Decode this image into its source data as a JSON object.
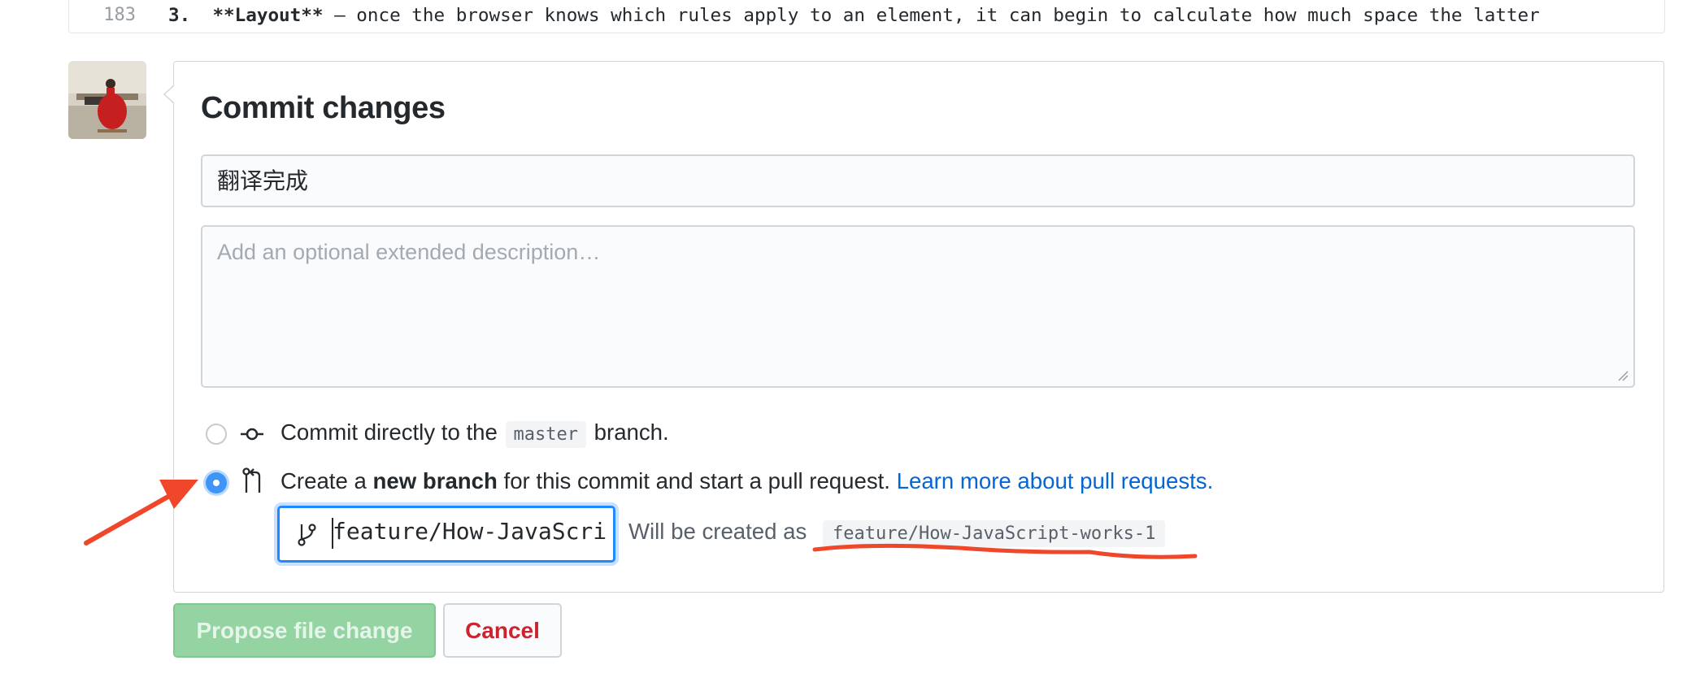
{
  "code_line": {
    "number": "183",
    "marker": "3.",
    "bold_text": "**Layout**",
    "text": " — once the browser knows which rules apply to an element, it can begin to calculate how much space the latter"
  },
  "commit": {
    "title": "Commit changes",
    "summary_value": "翻译完成",
    "description_placeholder": "Add an optional extended description…",
    "option_direct": {
      "before": "Commit directly to the",
      "branch": "master",
      "after": "branch."
    },
    "option_new": {
      "before": "Create a",
      "bold": "new branch",
      "after": "for this commit and start a pull request.",
      "link": "Learn more about pull requests."
    },
    "branch_input_value": "feature/How-JavaScri",
    "will_be_created": "Will be created as",
    "new_branch_name": "feature/How-JavaScript-works-1"
  },
  "buttons": {
    "propose": "Propose file change",
    "cancel": "Cancel"
  },
  "colors": {
    "annotation": "#f0472a",
    "link": "#0366d6",
    "radio_selected": "#3f94f7"
  },
  "icons": {
    "commit": "git-commit-icon",
    "pull_request": "git-pull-request-icon",
    "branch": "git-branch-icon"
  }
}
